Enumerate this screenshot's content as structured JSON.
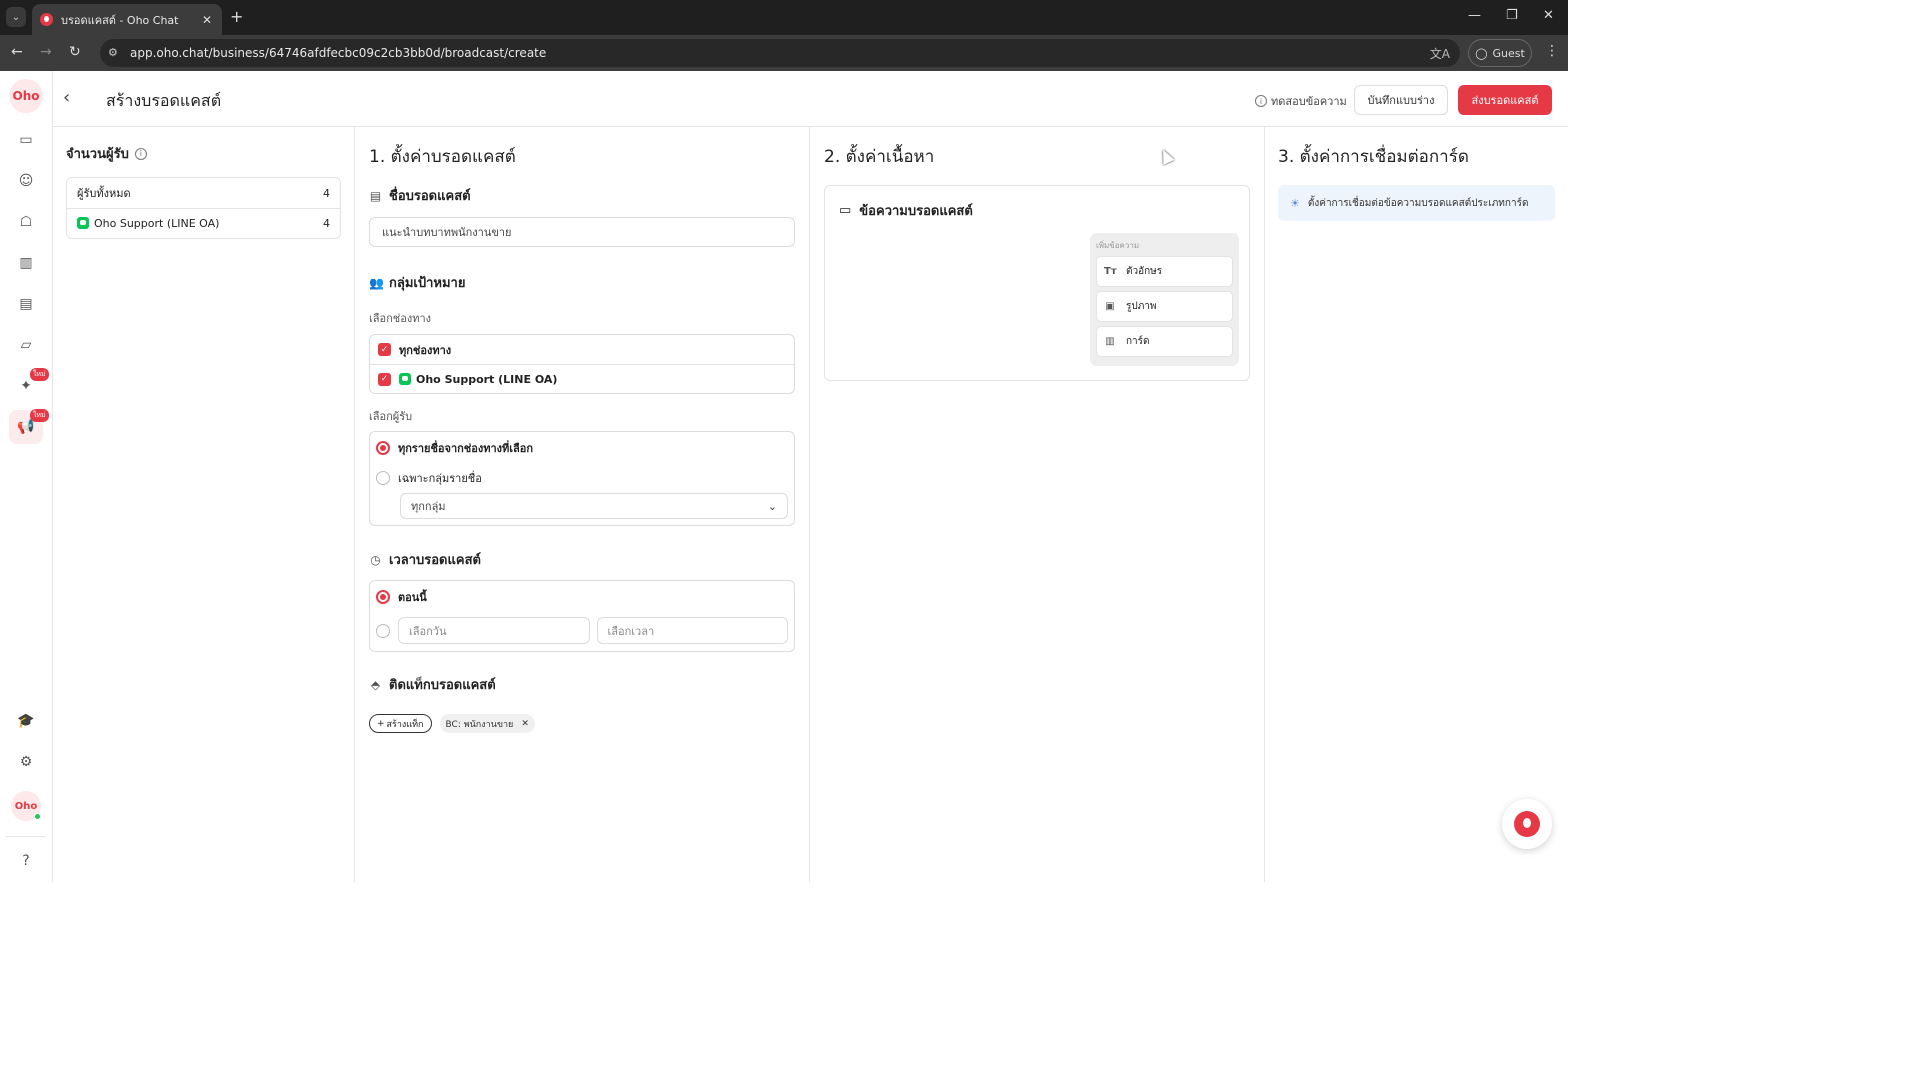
{
  "browser": {
    "tab_title": "บรอดแคสต์ - Oho Chat",
    "url": "app.oho.chat/business/64746afdfecbc09c2cb3bb0d/broadcast/create",
    "profile_label": "Guest"
  },
  "sidebar": {
    "logo_text": "Oho",
    "new_badge": "ใหม่",
    "avatar_text": "Oho"
  },
  "header": {
    "title": "สร้างบรอดแคสต์",
    "test_message": "ทดสอบข้อความ",
    "save_draft": "บันทึกแบบร่าง",
    "send_broadcast": "ส่งบรอดแคสต์"
  },
  "recipients": {
    "title": "จำนวนผู้รับ",
    "rows": [
      {
        "label": "ผู้รับทั้งหมด",
        "count": "4"
      },
      {
        "label": "Oho Support (LINE OA)",
        "count": "4"
      }
    ]
  },
  "step1": {
    "title": "1. ตั้งค่าบรอดแคสต์",
    "name_section": "ชื่อบรอดแคสต์",
    "name_value": "แนะนำบทบาทพนักงานขาย",
    "target_section": "กลุ่มเป้าหมาย",
    "channel_label": "เลือกช่องทาง",
    "channels": [
      "ทุกช่องทาง",
      "Oho Support (LINE OA)"
    ],
    "recipient_label": "เลือกผู้รับ",
    "recipient_all": "ทุกรายชื่อจากช่องทางที่เลือก",
    "recipient_group": "เฉพาะกลุ่มรายชื่อ",
    "group_select": "ทุกกลุ่ม",
    "time_section": "เวลาบรอดแคสต์",
    "time_now": "ตอนนี้",
    "date_placeholder": "เลือกวัน",
    "time_placeholder": "เลือกเวลา",
    "tag_section": "ติดแท็กบรอดแคสต์",
    "create_tag": "สร้างแท็ก",
    "tags": [
      "BC: พนักงานขาย"
    ]
  },
  "step2": {
    "title": "2. ตั้งค่าเนื้อหา",
    "card_title": "ข้อความบรอดแคสต์",
    "add_label": "เพิ่มข้อความ",
    "options": [
      "ตัวอักษร",
      "รูปภาพ",
      "การ์ด"
    ]
  },
  "step3": {
    "title": "3. ตั้งค่าการเชื่อมต่อการ์ด",
    "info": "ตั้งค่าการเชื่อมต่อข้อความบรอดแคสต์ประเภทการ์ด"
  },
  "colors": {
    "accent": "#e53945",
    "line_green": "#06c755",
    "info_bg": "#eef4fb"
  }
}
